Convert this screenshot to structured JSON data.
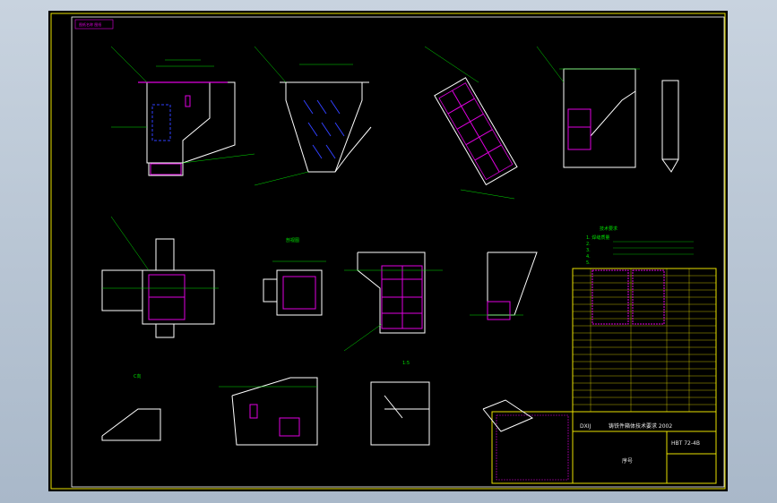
{
  "title_block": {
    "company": "DXIJ",
    "drawing_title": "铸铁件箱体技术要求 2002",
    "drawing_number": "HBT 72-4B",
    "row_label": "序号"
  },
  "stamp": "图纸名称 图纸",
  "technical_requirements": {
    "heading": "技术要求",
    "lines": [
      "1. 焊缝质量",
      "2.",
      "3.",
      "4.",
      "5."
    ]
  },
  "views": {
    "top_left": "剖视图",
    "view_a": "A向",
    "view_b": "B向",
    "view_c": "C向",
    "view_d": "D向",
    "scale": "1:5"
  },
  "colors": {
    "frame": "#e8e000",
    "outline": "#ffffff",
    "dim": "#00e000",
    "hatch": "#e000e0",
    "plate": "#3040ff"
  }
}
